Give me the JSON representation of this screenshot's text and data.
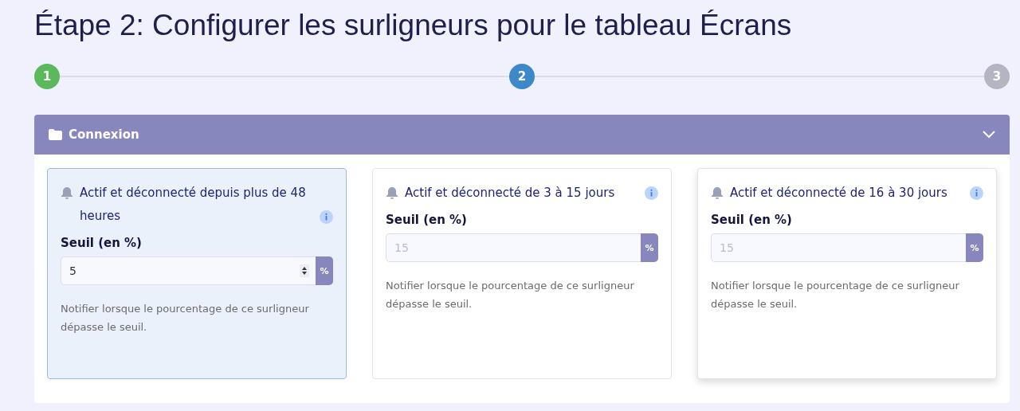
{
  "title": "Étape 2: Configurer les surligneurs pour le tableau Écrans",
  "steps": [
    {
      "label": "1",
      "completed": true,
      "selected": false
    },
    {
      "label": "2",
      "completed": false,
      "selected": true
    },
    {
      "label": "3",
      "completed": false,
      "selected": false
    }
  ],
  "section": {
    "title": "Connexion",
    "expanded": true,
    "cards": [
      {
        "title": "Actif et déconnecté depuis plus de 48 heures",
        "selected": true,
        "elevated": false,
        "field_label": "Seuil (en %)",
        "value": "5",
        "unit": "%",
        "help": "Notifier lorsque le pourcentage de ce surligneur dépasse le seuil."
      },
      {
        "title": "Actif et déconnecté de 3 à 15 jours",
        "selected": false,
        "elevated": false,
        "field_label": "Seuil (en %)",
        "placeholder": "15",
        "unit": "%",
        "help": "Notifier lorsque le pourcentage de ce surligneur dépasse le seuil."
      },
      {
        "title": "Actif et déconnecté de 16 à 30 jours",
        "selected": false,
        "elevated": true,
        "field_label": "Seuil (en %)",
        "placeholder": "15",
        "unit": "%",
        "help": "Notifier lorsque le pourcentage de ce surligneur dépasse le seuil."
      }
    ]
  }
}
